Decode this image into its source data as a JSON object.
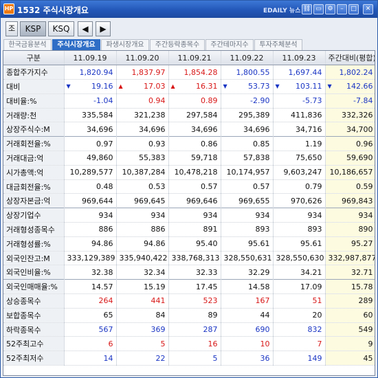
{
  "window": {
    "app_icon": "HP",
    "title": "1532 주식시장개요",
    "brand": "EDAILY 뉴스"
  },
  "toolbar": {
    "buttons": [
      "조",
      "KSP",
      "KSQ",
      "◀",
      "▶"
    ]
  },
  "tabs": [
    "한국금융분석",
    "주식시장개요",
    "파생시장개요",
    "주간등락종목수",
    "주간테마지수",
    "투자주체분석"
  ],
  "active_tab": 1,
  "table": {
    "headers": [
      "구분",
      "11.09.19",
      "11.09.20",
      "11.09.21",
      "11.09.22",
      "11.09.23",
      "주간대비(평합)"
    ],
    "rows": [
      {
        "label": "종합주가지수",
        "values": [
          "1,820.94",
          "1,837.97",
          "1,854.28",
          "1,800.55",
          "1,697.44",
          "1,802.24"
        ],
        "colors": [
          "down",
          "up",
          "up",
          "down",
          "down",
          "down"
        ]
      },
      {
        "label": "대비",
        "values": [
          "19.16",
          "17.03",
          "16.31",
          "53.73",
          "103.11",
          "142.66"
        ],
        "colors": [
          "down",
          "up",
          "up",
          "down",
          "down",
          "down"
        ],
        "arrows": [
          "▼",
          "▲",
          "▲",
          "▼",
          "▼",
          "▼"
        ]
      },
      {
        "label": "대비율:%",
        "values": [
          "-1.04",
          "0.94",
          "0.89",
          "-2.90",
          "-5.73",
          "-7.84"
        ],
        "colors": [
          "down",
          "up",
          "up",
          "down",
          "down",
          "down"
        ]
      },
      {
        "label": "거래량:천",
        "values": [
          "335,584",
          "321,238",
          "297,584",
          "295,389",
          "411,836",
          "332,326"
        ],
        "colors": [
          "blk",
          "blk",
          "blk",
          "blk",
          "blk",
          "blk"
        ]
      },
      {
        "label": "상장주식수:M",
        "values": [
          "34,696",
          "34,696",
          "34,696",
          "34,696",
          "34,716",
          "34,700"
        ],
        "colors": [
          "blk",
          "blk",
          "blk",
          "blk",
          "blk",
          "blk"
        ]
      },
      {
        "label": "거래회전율:%",
        "values": [
          "0.97",
          "0.93",
          "0.86",
          "0.85",
          "1.19",
          "0.96"
        ],
        "colors": [
          "blk",
          "blk",
          "blk",
          "blk",
          "blk",
          "blk"
        ],
        "sep": true
      },
      {
        "label": "거래대금:억",
        "values": [
          "49,860",
          "55,383",
          "59,718",
          "57,838",
          "75,650",
          "59,690"
        ],
        "colors": [
          "blk",
          "blk",
          "blk",
          "blk",
          "blk",
          "blk"
        ]
      },
      {
        "label": "시가총액:억",
        "values": [
          "10,289,577",
          "10,387,284",
          "10,478,218",
          "10,174,957",
          "9,603,247",
          "10,186,657"
        ],
        "colors": [
          "blk",
          "blk",
          "blk",
          "blk",
          "blk",
          "blk"
        ]
      },
      {
        "label": "대금회전율:%",
        "values": [
          "0.48",
          "0.53",
          "0.57",
          "0.57",
          "0.79",
          "0.59"
        ],
        "colors": [
          "blk",
          "blk",
          "blk",
          "blk",
          "blk",
          "blk"
        ]
      },
      {
        "label": "상장자본금:억",
        "values": [
          "969,644",
          "969,645",
          "969,646",
          "969,655",
          "970,626",
          "969,843"
        ],
        "colors": [
          "blk",
          "blk",
          "blk",
          "blk",
          "blk",
          "blk"
        ]
      },
      {
        "label": "상장기업수",
        "values": [
          "934",
          "934",
          "934",
          "934",
          "934",
          "934"
        ],
        "colors": [
          "blk",
          "blk",
          "blk",
          "blk",
          "blk",
          "blk"
        ],
        "sep": true
      },
      {
        "label": "거래형성종목수",
        "values": [
          "886",
          "886",
          "891",
          "893",
          "893",
          "890"
        ],
        "colors": [
          "blk",
          "blk",
          "blk",
          "blk",
          "blk",
          "blk"
        ]
      },
      {
        "label": "거래형성률:%",
        "values": [
          "94.86",
          "94.86",
          "95.40",
          "95.61",
          "95.61",
          "95.27"
        ],
        "colors": [
          "blk",
          "blk",
          "blk",
          "blk",
          "blk",
          "blk"
        ]
      },
      {
        "label": "외국인잔고:M",
        "values": [
          "333,129,389",
          "335,940,422",
          "338,768,313",
          "328,550,631",
          "328,550,630",
          "332,987,877"
        ],
        "colors": [
          "blk",
          "blk",
          "blk",
          "blk",
          "blk",
          "blk"
        ]
      },
      {
        "label": "외국인비율:%",
        "values": [
          "32.38",
          "32.34",
          "32.33",
          "32.29",
          "34.21",
          "32.71"
        ],
        "colors": [
          "blk",
          "blk",
          "blk",
          "blk",
          "blk",
          "blk"
        ]
      },
      {
        "label": "외국인매매율:%",
        "values": [
          "14.57",
          "15.19",
          "17.45",
          "14.58",
          "17.09",
          "15.78"
        ],
        "colors": [
          "blk",
          "blk",
          "blk",
          "blk",
          "blk",
          "blk"
        ],
        "sep": true
      },
      {
        "label": "상승종목수",
        "values": [
          "264",
          "441",
          "523",
          "167",
          "51",
          "289"
        ],
        "colors": [
          "up",
          "up",
          "up",
          "up",
          "up",
          "blk"
        ]
      },
      {
        "label": "보합종목수",
        "values": [
          "65",
          "84",
          "89",
          "44",
          "20",
          "60"
        ],
        "colors": [
          "blk",
          "blk",
          "blk",
          "blk",
          "blk",
          "blk"
        ]
      },
      {
        "label": "하락종목수",
        "values": [
          "567",
          "369",
          "287",
          "690",
          "832",
          "549"
        ],
        "colors": [
          "down",
          "down",
          "down",
          "down",
          "down",
          "blk"
        ]
      },
      {
        "label": "52주최고수",
        "values": [
          "6",
          "5",
          "16",
          "10",
          "7",
          "9"
        ],
        "colors": [
          "up",
          "up",
          "up",
          "up",
          "up",
          "blk"
        ]
      },
      {
        "label": "52주최저수",
        "values": [
          "14",
          "22",
          "5",
          "36",
          "149",
          "45"
        ],
        "colors": [
          "down",
          "down",
          "down",
          "down",
          "down",
          "blk"
        ]
      }
    ]
  },
  "colors": {
    "up": "#d81717",
    "down": "#1a35c4",
    "titlebar": "#2357b8",
    "weekly_col": "#fdfbe0"
  }
}
